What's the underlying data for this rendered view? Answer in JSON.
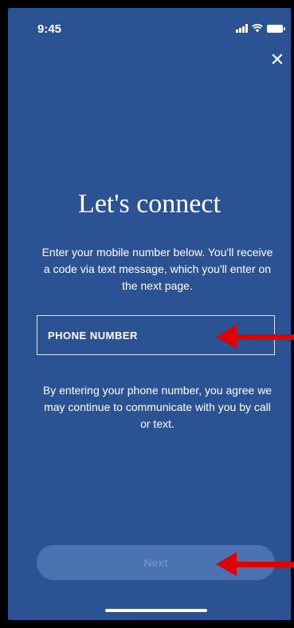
{
  "status_bar": {
    "time": "9:45"
  },
  "header": {
    "close_icon": "close-icon"
  },
  "main": {
    "title": "Let's connect",
    "subtitle": "Enter your mobile number below. You'll receive a code via text message, which you'll enter on the next page.",
    "phone_field": {
      "placeholder": "PHONE NUMBER",
      "value": ""
    },
    "consent_text": "By entering your phone number, you agree we may continue to communicate with you by call or text."
  },
  "footer": {
    "next_label": "Next"
  },
  "colors": {
    "background": "#2b5394",
    "annotation_arrow": "#e00000",
    "button_disabled": "#4a71b0"
  }
}
